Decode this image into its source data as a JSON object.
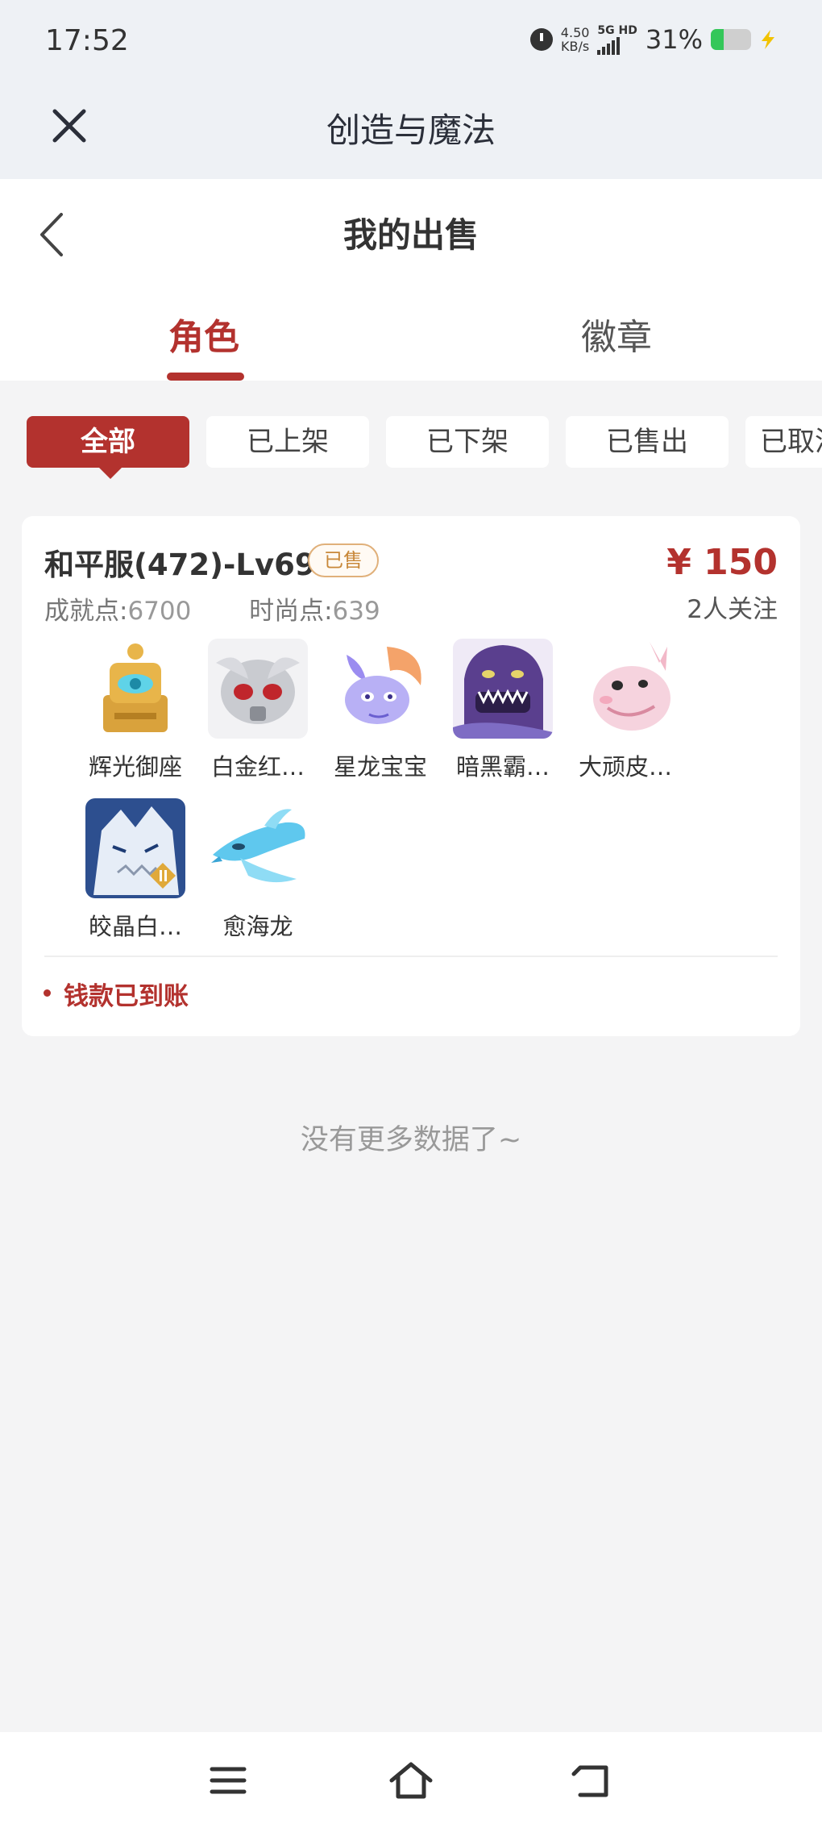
{
  "status_bar": {
    "time": "17:52",
    "net_speed_value": "4.50",
    "net_speed_unit": "KB/s",
    "network_top": "5G HD",
    "battery_percent": "31%",
    "battery_level": 0.31
  },
  "app": {
    "title": "创造与魔法"
  },
  "header": {
    "title": "我的出售",
    "tabs": [
      {
        "label": "角色",
        "active": true
      },
      {
        "label": "徽章",
        "active": false
      }
    ]
  },
  "filters": [
    {
      "label": "全部",
      "active": true
    },
    {
      "label": "已上架",
      "active": false
    },
    {
      "label": "已下架",
      "active": false
    },
    {
      "label": "已售出",
      "active": false
    },
    {
      "label": "已取消",
      "active": false
    }
  ],
  "listing": {
    "name": "和平服(472)-Lv69",
    "badge": "已售",
    "price": "¥ 150",
    "achievement_label": "成就点:",
    "achievement_value": "6700",
    "fashion_label": "时尚点:",
    "fashion_value": "639",
    "followers": "2人关注",
    "pets": [
      {
        "name": "辉光御座"
      },
      {
        "name": "白金红…"
      },
      {
        "name": "星龙宝宝"
      },
      {
        "name": "暗黑霸…"
      },
      {
        "name": "大顽皮…"
      },
      {
        "name": "皎晶白…"
      },
      {
        "name": "愈海龙"
      }
    ],
    "status": "钱款已到账"
  },
  "footer_text": "没有更多数据了~",
  "colors": {
    "accent": "#b3322e",
    "background": "#f4f4f5",
    "badge_border": "#e0b07a"
  }
}
